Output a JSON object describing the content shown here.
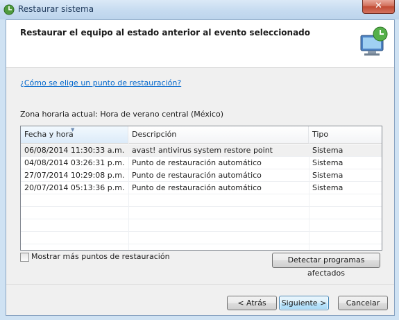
{
  "window": {
    "title": "Restaurar sistema",
    "close_label": "✕"
  },
  "header": {
    "title": "Restaurar el equipo al estado anterior al evento seleccionado"
  },
  "help_link": "¿Cómo se elige un punto de restauración?",
  "timezone_label": "Zona horaria actual: Hora de verano central (México)",
  "table": {
    "columns": [
      "Fecha y hora",
      "Descripción",
      "Tipo"
    ],
    "rows": [
      [
        "06/08/2014 11:30:33 a.m.",
        "avast! antivirus system restore point",
        "Sistema"
      ],
      [
        "04/08/2014 03:26:31 p.m.",
        "Punto de restauración automático",
        "Sistema"
      ],
      [
        "27/07/2014 10:29:08 p.m.",
        "Punto de restauración automático",
        "Sistema"
      ],
      [
        "20/07/2014 05:13:36 p.m.",
        "Punto de restauración automático",
        "Sistema"
      ]
    ]
  },
  "show_more_label": "Mostrar más puntos de restauración",
  "buttons": {
    "detect": "Detectar programas afectados",
    "back": "< Atrás",
    "next": "Siguiente >",
    "cancel": "Cancelar"
  }
}
